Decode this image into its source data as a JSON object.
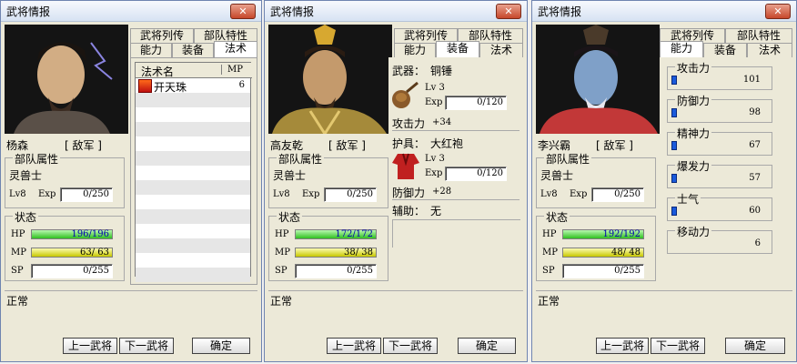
{
  "windows": [
    {
      "title": "武将情报",
      "close": "✕",
      "name": "杨森",
      "side": "[ 敌军 ]",
      "tabs_row1": [
        "武将列传",
        "部队特性"
      ],
      "tabs_row2": [
        "能力",
        "装备",
        "法术"
      ],
      "active_tab": "法术",
      "unit_group": "部队属性",
      "unit_type": "灵兽士",
      "lv": "Lv8",
      "exp_label": "Exp",
      "exp_value": "0/250",
      "status_group": "状态",
      "hp_label": "HP",
      "hp_value": "196/196",
      "hp_fill": 1.0,
      "mp_label": "MP",
      "mp_value": "63/ 63",
      "mp_fill": 1.0,
      "sp_label": "SP",
      "sp_value": "0/255",
      "condition": "正常",
      "prev_label": "上一武将",
      "next_label": "下一武将",
      "ok_label": "确定",
      "spells_header": {
        "name": "法术名",
        "mp": "MP"
      },
      "spells": [
        {
          "name": "开天珠",
          "mp": "6",
          "icon": "fire-spell-icon"
        }
      ]
    },
    {
      "title": "武将情报",
      "close": "✕",
      "name": "高友乾",
      "side": "[ 敌军 ]",
      "tabs_row1": [
        "武将列传",
        "部队特性"
      ],
      "tabs_row2": [
        "能力",
        "装备",
        "法术"
      ],
      "active_tab": "装备",
      "unit_group": "部队属性",
      "unit_type": "灵兽士",
      "lv": "Lv8",
      "exp_label": "Exp",
      "exp_value": "0/250",
      "status_group": "状态",
      "hp_label": "HP",
      "hp_value": "172/172",
      "hp_fill": 1.0,
      "mp_label": "MP",
      "mp_value": "38/ 38",
      "mp_fill": 1.0,
      "sp_label": "SP",
      "sp_value": "0/255",
      "condition": "正常",
      "prev_label": "上一武将",
      "next_label": "下一武将",
      "ok_label": "确定",
      "equip": {
        "weapon_label": "武器：",
        "weapon_name": "铜锤",
        "weapon_lv": "Lv 3",
        "weapon_exp_label": "Exp",
        "weapon_exp": "0/120",
        "atk_label": "攻击力",
        "atk_value": "+34",
        "armor_label": "护具：",
        "armor_name": "大红袍",
        "armor_lv": "Lv 3",
        "armor_exp_label": "Exp",
        "armor_exp": "0/120",
        "def_label": "防御力",
        "def_value": "+28",
        "aux_label": "辅助：",
        "aux_name": "无"
      }
    },
    {
      "title": "武将情报",
      "close": "✕",
      "name": "李兴霸",
      "side": "[ 敌军 ]",
      "tabs_row1": [
        "武将列传",
        "部队特性"
      ],
      "tabs_row2": [
        "能力",
        "装备",
        "法术"
      ],
      "active_tab": "能力",
      "unit_group": "部队属性",
      "unit_type": "灵兽士",
      "lv": "Lv8",
      "exp_label": "Exp",
      "exp_value": "0/250",
      "status_group": "状态",
      "hp_label": "HP",
      "hp_value": "192/192",
      "hp_fill": 1.0,
      "mp_label": "MP",
      "mp_value": "48/ 48",
      "mp_fill": 1.0,
      "sp_label": "SP",
      "sp_value": "0/255",
      "condition": "正常",
      "prev_label": "上一武将",
      "next_label": "下一武将",
      "ok_label": "确定",
      "abilities": [
        {
          "label": "攻击力",
          "value": "101"
        },
        {
          "label": "防御力",
          "value": "98"
        },
        {
          "label": "精神力",
          "value": "67"
        },
        {
          "label": "爆发力",
          "value": "57"
        },
        {
          "label": "士气",
          "value": "60"
        },
        {
          "label": "移动力",
          "value": "6"
        }
      ]
    }
  ]
}
